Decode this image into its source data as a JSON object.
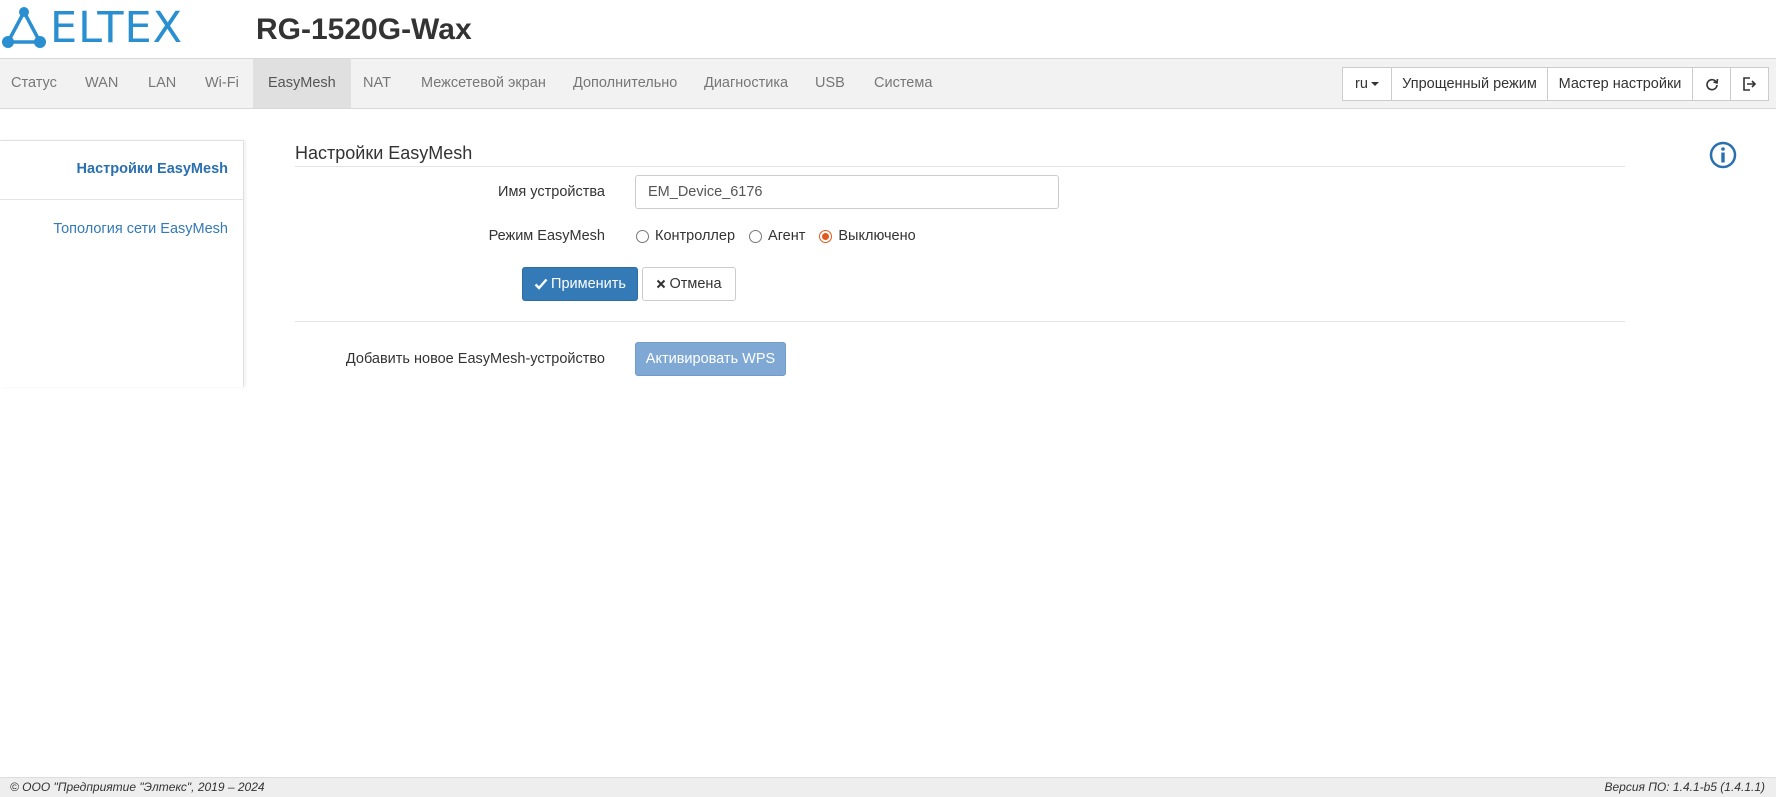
{
  "header": {
    "logo_text": "ELTEX",
    "model": "RG-1520G-Wax"
  },
  "nav": {
    "items": [
      {
        "label": "Статус",
        "active": false
      },
      {
        "label": "WAN",
        "active": false
      },
      {
        "label": "LAN",
        "active": false
      },
      {
        "label": "Wi-Fi",
        "active": false
      },
      {
        "label": "EasyMesh",
        "active": true
      },
      {
        "label": "NAT",
        "active": false
      },
      {
        "label": "Межсетевой экран",
        "active": false
      },
      {
        "label": "Дополнительно",
        "active": false
      },
      {
        "label": "Диагностика",
        "active": false
      },
      {
        "label": "USB",
        "active": false
      },
      {
        "label": "Система",
        "active": false
      }
    ],
    "lang": "ru",
    "simple_mode": "Упрощенный режим",
    "wizard": "Мастер настройки",
    "refresh_icon": "refresh-icon",
    "logout_icon": "logout-icon"
  },
  "sidebar": {
    "items": [
      {
        "label": "Настройки EasyMesh",
        "active": true
      },
      {
        "label": "Топология сети EasyMesh",
        "active": false
      }
    ]
  },
  "main": {
    "title": "Настройки EasyMesh",
    "info_icon": "info-icon",
    "device_name_label": "Имя устройства",
    "device_name_value": "EM_Device_6176",
    "mode_label": "Режим EasyMesh",
    "mode_options": [
      {
        "label": "Контроллер",
        "checked": false
      },
      {
        "label": "Агент",
        "checked": false
      },
      {
        "label": "Выключено",
        "checked": true
      }
    ],
    "apply_label": "Применить",
    "cancel_label": "Отмена",
    "add_device_label": "Добавить новое EasyMesh-устройство",
    "wps_label": "Активировать WPS"
  },
  "footer": {
    "copyright": "© ООО \"Предприятие \"Элтекс\", 2019 – 2024",
    "version": "Версия ПО: 1.4.1-b5 (1.4.1.1)"
  },
  "colors": {
    "brand": "#2a8fd0",
    "primary": "#337ab7",
    "radio_checked": "#e05a1e",
    "wps_button": "#7fa9d4"
  }
}
